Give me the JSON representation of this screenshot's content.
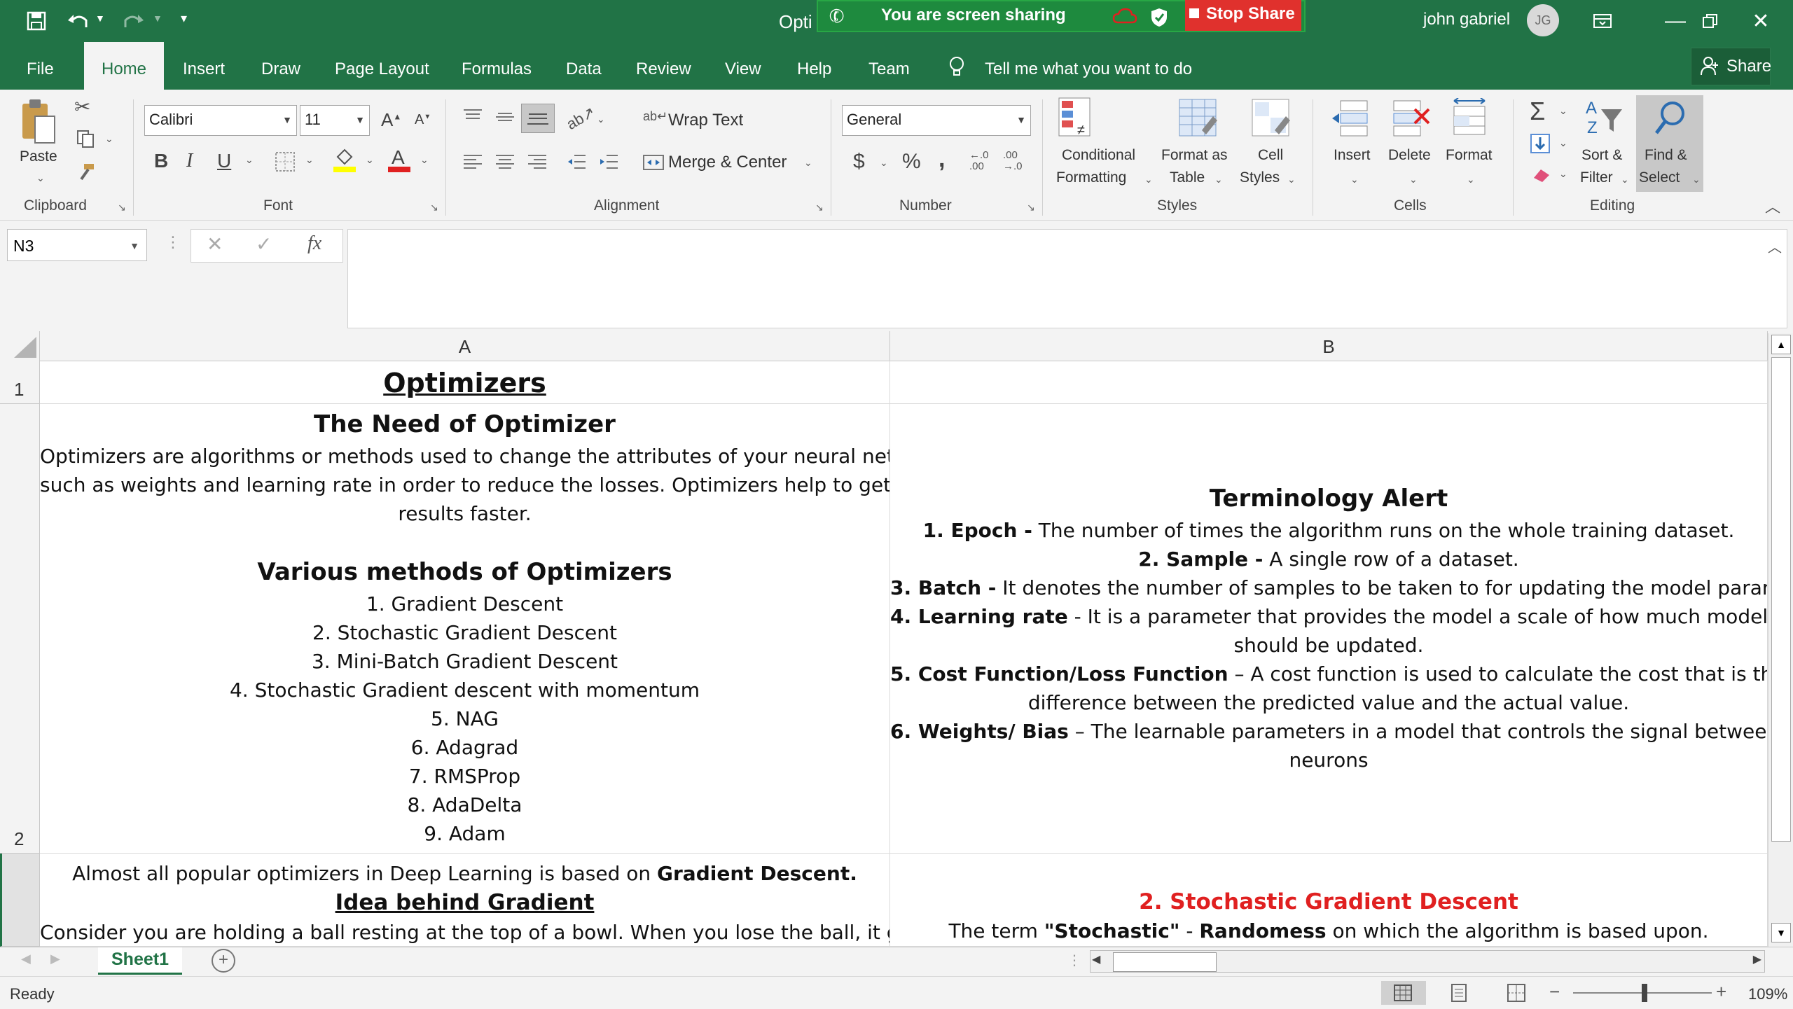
{
  "window": {
    "doc_title": "Opti",
    "user_name": "john gabriel",
    "user_initials": "JG"
  },
  "share": {
    "banner_text": "You are screen sharing",
    "stop_label": "Stop Share"
  },
  "tabs": [
    "File",
    "Home",
    "Insert",
    "Draw",
    "Page Layout",
    "Formulas",
    "Data",
    "Review",
    "View",
    "Help",
    "Team"
  ],
  "tell_me": "Tell me what you want to do",
  "share_button": "Share",
  "ribbon": {
    "clipboard": {
      "paste": "Paste",
      "group": "Clipboard"
    },
    "font": {
      "name": "Calibri",
      "size": "11",
      "bold": "B",
      "italic": "I",
      "underline": "U",
      "group": "Font"
    },
    "alignment": {
      "wrap_text": "Wrap Text",
      "merge_center": "Merge & Center",
      "group": "Alignment"
    },
    "number": {
      "format": "General",
      "currency": "$",
      "percent": "%",
      "comma": ",",
      "group": "Number"
    },
    "styles": {
      "conditional_1": "Conditional",
      "conditional_2": "Formatting",
      "format_table_1": "Format as",
      "format_table_2": "Table",
      "cell_styles_1": "Cell",
      "cell_styles_2": "Styles",
      "group": "Styles"
    },
    "cells": {
      "insert": "Insert",
      "delete": "Delete",
      "format": "Format",
      "group": "Cells"
    },
    "editing": {
      "sort_1": "Sort &",
      "sort_2": "Filter",
      "find_1": "Find &",
      "find_2": "Select",
      "group": "Editing"
    }
  },
  "formula_bar": {
    "name_box": "N3",
    "fx": "fx",
    "value": ""
  },
  "columns": [
    "A",
    "B"
  ],
  "rows": [
    "1",
    "2"
  ],
  "cellA1": "Optimizers",
  "cellA2": {
    "heading": "The Need of Optimizer",
    "para": [
      "Optimizers are algorithms or methods used to change the attributes of your neural network",
      "such as weights and learning rate in order to reduce the losses. Optimizers help to get",
      "results faster."
    ],
    "methods_heading": "Various methods of Optimizers",
    "methods": [
      "1. Gradient Descent",
      "2. Stochastic Gradient Descent",
      "3. Mini-Batch Gradient Descent",
      "4. Stochastic Gradient descent with momentum",
      "5. NAG",
      "6. Adagrad",
      "7. RMSProp",
      "8. AdaDelta",
      "9. Adam"
    ]
  },
  "cellB2": {
    "heading": "Terminology Alert",
    "items": [
      {
        "term": "1. Epoch -",
        "text": " The number of times the algorithm runs on the whole training dataset."
      },
      {
        "term": "2. Sample -",
        "text": " A single row of a dataset."
      },
      {
        "term": "3. Batch -",
        "text": " It denotes the number of samples to be taken to for updating the model parameters."
      },
      {
        "term": "4. Learning rate",
        "text": " - It is a parameter that provides the model a scale of how much model weights"
      },
      {
        "term": "",
        "text": "should be updated."
      },
      {
        "term": "5. Cost Function/Loss Function",
        "text": " – A cost function is used to calculate the cost that is the"
      },
      {
        "term": "",
        "text": "difference between the predicted value and the actual value."
      },
      {
        "term": "6. Weights/ Bias",
        "text": " – The learnable parameters in a model that controls the signal between two"
      },
      {
        "term": "",
        "text": "neurons"
      }
    ]
  },
  "cellA3": {
    "line1_pre": "Almost all popular optimizers in Deep Learning is based on ",
    "line1_bold": "Gradient Descent.",
    "heading": "Idea behind Gradient",
    "line3": "Consider you are holding a ball resting at the top of a bowl. When you lose the ball, it goes"
  },
  "cellB3": {
    "heading": "2. Stochastic Gradient Descent",
    "pre": "The term ",
    "b1": "\"Stochastic\"",
    "mid": " - ",
    "b2": "Randomess",
    "post": " on which the algorithm is based upon."
  },
  "sheet_tabs": [
    "Sheet1"
  ],
  "status": {
    "ready": "Ready",
    "zoom": "109%"
  },
  "colors": {
    "excel_green": "#217346",
    "accent_red": "#e02020"
  }
}
